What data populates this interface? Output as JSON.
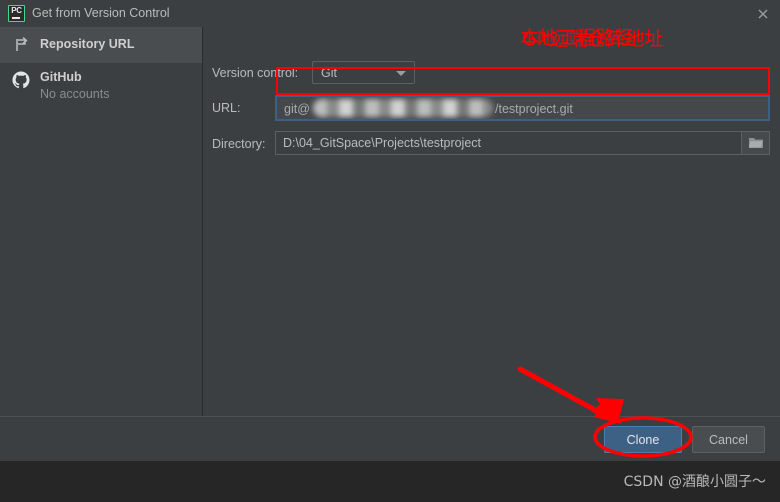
{
  "window": {
    "title": "Get from Version Control",
    "app_icon": "pycharm-icon",
    "app_icon_text": "PC",
    "close_icon": "close-icon"
  },
  "sidebar": {
    "items": [
      {
        "label": "Repository URL",
        "icon": "branch-icon",
        "selected": true
      },
      {
        "label": "GitHub",
        "sublabel": "No accounts",
        "icon": "github-icon",
        "selected": false
      }
    ]
  },
  "form": {
    "version_control": {
      "label": "Version control:",
      "value": "Git",
      "options": [
        "Git"
      ],
      "chevron_icon": "chevron-down-icon"
    },
    "url": {
      "label": "URL:",
      "value_prefix": "git@",
      "value_redacted": true,
      "value_suffix": "/testproject.git",
      "placeholder": "",
      "focused": true,
      "annotation": "Git远端仓库地址"
    },
    "directory": {
      "label": "Directory:",
      "value": "D:\\04_GitSpace\\Projects\\testproject",
      "placeholder": "",
      "browse_icon": "folder-icon",
      "annotation": "本地工程路径"
    }
  },
  "buttons": {
    "clone": "Clone",
    "cancel": "Cancel"
  },
  "annotations": {
    "highlight_color": "#ff0000",
    "arrow": "red-arrow-to-clone",
    "ellipse": "red-ellipse-around-clone"
  },
  "watermark": {
    "text": "CSDN @酒酿小圆子～"
  },
  "colors": {
    "dialog_background": "#3c3f41",
    "sidebar_selected": "#4a4d4f",
    "accent_button": "#3d6185",
    "field_border": "#5e6060",
    "focus_border": "#3d6185",
    "annotation_red": "#ff0000",
    "page_background": "#262626"
  }
}
